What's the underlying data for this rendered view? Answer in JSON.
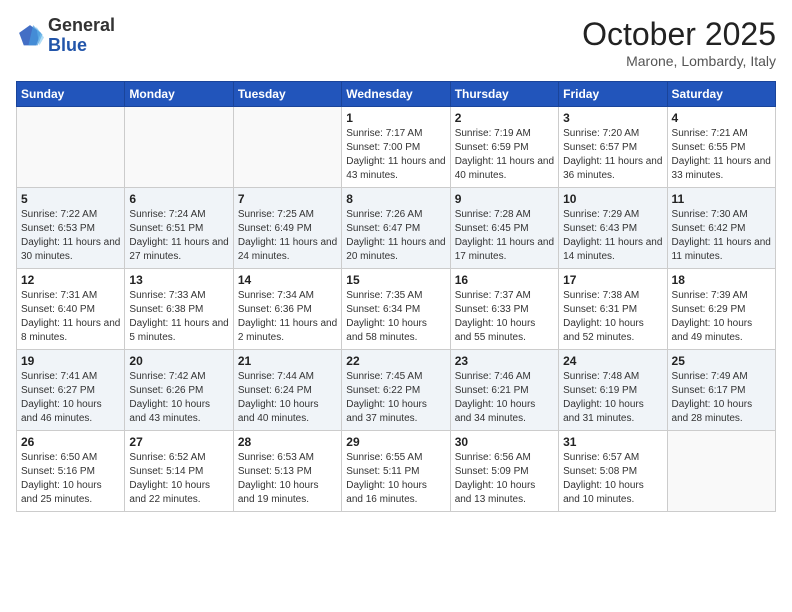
{
  "header": {
    "logo_general": "General",
    "logo_blue": "Blue",
    "month_title": "October 2025",
    "location": "Marone, Lombardy, Italy"
  },
  "days_of_week": [
    "Sunday",
    "Monday",
    "Tuesday",
    "Wednesday",
    "Thursday",
    "Friday",
    "Saturday"
  ],
  "weeks": [
    [
      {
        "day": "",
        "info": ""
      },
      {
        "day": "",
        "info": ""
      },
      {
        "day": "",
        "info": ""
      },
      {
        "day": "1",
        "info": "Sunrise: 7:17 AM\nSunset: 7:00 PM\nDaylight: 11 hours and 43 minutes."
      },
      {
        "day": "2",
        "info": "Sunrise: 7:19 AM\nSunset: 6:59 PM\nDaylight: 11 hours and 40 minutes."
      },
      {
        "day": "3",
        "info": "Sunrise: 7:20 AM\nSunset: 6:57 PM\nDaylight: 11 hours and 36 minutes."
      },
      {
        "day": "4",
        "info": "Sunrise: 7:21 AM\nSunset: 6:55 PM\nDaylight: 11 hours and 33 minutes."
      }
    ],
    [
      {
        "day": "5",
        "info": "Sunrise: 7:22 AM\nSunset: 6:53 PM\nDaylight: 11 hours and 30 minutes."
      },
      {
        "day": "6",
        "info": "Sunrise: 7:24 AM\nSunset: 6:51 PM\nDaylight: 11 hours and 27 minutes."
      },
      {
        "day": "7",
        "info": "Sunrise: 7:25 AM\nSunset: 6:49 PM\nDaylight: 11 hours and 24 minutes."
      },
      {
        "day": "8",
        "info": "Sunrise: 7:26 AM\nSunset: 6:47 PM\nDaylight: 11 hours and 20 minutes."
      },
      {
        "day": "9",
        "info": "Sunrise: 7:28 AM\nSunset: 6:45 PM\nDaylight: 11 hours and 17 minutes."
      },
      {
        "day": "10",
        "info": "Sunrise: 7:29 AM\nSunset: 6:43 PM\nDaylight: 11 hours and 14 minutes."
      },
      {
        "day": "11",
        "info": "Sunrise: 7:30 AM\nSunset: 6:42 PM\nDaylight: 11 hours and 11 minutes."
      }
    ],
    [
      {
        "day": "12",
        "info": "Sunrise: 7:31 AM\nSunset: 6:40 PM\nDaylight: 11 hours and 8 minutes."
      },
      {
        "day": "13",
        "info": "Sunrise: 7:33 AM\nSunset: 6:38 PM\nDaylight: 11 hours and 5 minutes."
      },
      {
        "day": "14",
        "info": "Sunrise: 7:34 AM\nSunset: 6:36 PM\nDaylight: 11 hours and 2 minutes."
      },
      {
        "day": "15",
        "info": "Sunrise: 7:35 AM\nSunset: 6:34 PM\nDaylight: 10 hours and 58 minutes."
      },
      {
        "day": "16",
        "info": "Sunrise: 7:37 AM\nSunset: 6:33 PM\nDaylight: 10 hours and 55 minutes."
      },
      {
        "day": "17",
        "info": "Sunrise: 7:38 AM\nSunset: 6:31 PM\nDaylight: 10 hours and 52 minutes."
      },
      {
        "day": "18",
        "info": "Sunrise: 7:39 AM\nSunset: 6:29 PM\nDaylight: 10 hours and 49 minutes."
      }
    ],
    [
      {
        "day": "19",
        "info": "Sunrise: 7:41 AM\nSunset: 6:27 PM\nDaylight: 10 hours and 46 minutes."
      },
      {
        "day": "20",
        "info": "Sunrise: 7:42 AM\nSunset: 6:26 PM\nDaylight: 10 hours and 43 minutes."
      },
      {
        "day": "21",
        "info": "Sunrise: 7:44 AM\nSunset: 6:24 PM\nDaylight: 10 hours and 40 minutes."
      },
      {
        "day": "22",
        "info": "Sunrise: 7:45 AM\nSunset: 6:22 PM\nDaylight: 10 hours and 37 minutes."
      },
      {
        "day": "23",
        "info": "Sunrise: 7:46 AM\nSunset: 6:21 PM\nDaylight: 10 hours and 34 minutes."
      },
      {
        "day": "24",
        "info": "Sunrise: 7:48 AM\nSunset: 6:19 PM\nDaylight: 10 hours and 31 minutes."
      },
      {
        "day": "25",
        "info": "Sunrise: 7:49 AM\nSunset: 6:17 PM\nDaylight: 10 hours and 28 minutes."
      }
    ],
    [
      {
        "day": "26",
        "info": "Sunrise: 6:50 AM\nSunset: 5:16 PM\nDaylight: 10 hours and 25 minutes."
      },
      {
        "day": "27",
        "info": "Sunrise: 6:52 AM\nSunset: 5:14 PM\nDaylight: 10 hours and 22 minutes."
      },
      {
        "day": "28",
        "info": "Sunrise: 6:53 AM\nSunset: 5:13 PM\nDaylight: 10 hours and 19 minutes."
      },
      {
        "day": "29",
        "info": "Sunrise: 6:55 AM\nSunset: 5:11 PM\nDaylight: 10 hours and 16 minutes."
      },
      {
        "day": "30",
        "info": "Sunrise: 6:56 AM\nSunset: 5:09 PM\nDaylight: 10 hours and 13 minutes."
      },
      {
        "day": "31",
        "info": "Sunrise: 6:57 AM\nSunset: 5:08 PM\nDaylight: 10 hours and 10 minutes."
      },
      {
        "day": "",
        "info": ""
      }
    ]
  ]
}
